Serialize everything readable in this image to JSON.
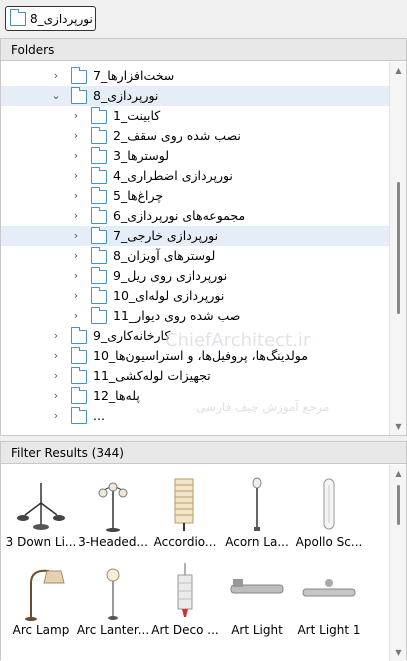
{
  "path_button": {
    "label": "نورپردازی_8"
  },
  "folders_panel": {
    "title": "Folders",
    "items": [
      {
        "label": "سخت‌افزارها_7",
        "level": 0,
        "expanded": false
      },
      {
        "label": "نورپردازی_8",
        "level": 0,
        "expanded": true,
        "selected": true
      },
      {
        "label": "کابینت_1",
        "level": 1,
        "expanded": false
      },
      {
        "label": "نصب شده روی سقف_2",
        "level": 1,
        "expanded": false
      },
      {
        "label": "لوسترها_3",
        "level": 1,
        "expanded": false
      },
      {
        "label": "نورپردازی اضطراری_4",
        "level": 1,
        "expanded": false
      },
      {
        "label": "چراغ‌ها_5",
        "level": 1,
        "expanded": false
      },
      {
        "label": "مجموعه‌های نورپردازی_6",
        "level": 1,
        "expanded": false
      },
      {
        "label": "نورپردازی خارجی_7",
        "level": 1,
        "expanded": false,
        "hover": true
      },
      {
        "label": "لوسترهای آویزان_8",
        "level": 1,
        "expanded": false
      },
      {
        "label": "نورپردازی روی ریل_9",
        "level": 1,
        "expanded": false
      },
      {
        "label": "نورپردازی لوله‌ای_10",
        "level": 1,
        "expanded": false
      },
      {
        "label": "صب شده روی دیوار_11",
        "level": 1,
        "expanded": false
      },
      {
        "label": "کارخانه‌کاری_9",
        "level": 0,
        "expanded": false
      },
      {
        "label": "مولدینگ‌ها، پروفیل‌ها، و استراسیون‌ها_10",
        "level": 0,
        "expanded": false
      },
      {
        "label": "تجهیزات لوله‌کشی_11",
        "level": 0,
        "expanded": false
      },
      {
        "label": "پله‌ها_12",
        "level": 0,
        "expanded": false
      },
      {
        "label": "...",
        "level": 0,
        "expanded": false
      }
    ]
  },
  "watermark": {
    "brand": "ChiefArchitect.ir",
    "tagline": "مرجع آموزش چیف فارسی"
  },
  "results_panel": {
    "title": "Filter Results (344)",
    "items": [
      {
        "label": "3 Down Li...",
        "icon": "three-arm-floor-lamp-icon"
      },
      {
        "label": "3-Headed...",
        "icon": "three-headed-lamp-icon"
      },
      {
        "label": "Accordio...",
        "icon": "accordion-lamp-icon"
      },
      {
        "label": "Acorn La...",
        "icon": "acorn-lamp-icon"
      },
      {
        "label": "Apollo Sc...",
        "icon": "apollo-sconce-icon"
      },
      {
        "label": "Arc Lamp",
        "icon": "arc-lamp-icon"
      },
      {
        "label": "Arc Lanter...",
        "icon": "arc-lantern-icon"
      },
      {
        "label": "Art Deco ...",
        "icon": "art-deco-lamp-icon"
      },
      {
        "label": "Art Light",
        "icon": "art-light-icon"
      },
      {
        "label": "Art Light 1",
        "icon": "art-light-1-icon"
      }
    ]
  }
}
